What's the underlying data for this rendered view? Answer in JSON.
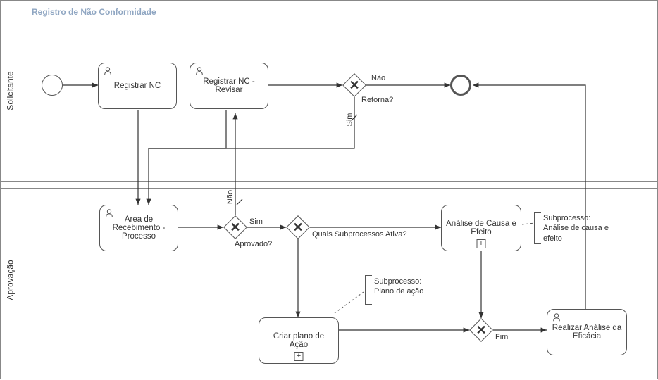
{
  "diagram": {
    "title": "Registro de Não Conformidade",
    "lanes": {
      "solicitante": {
        "label": "Solicitante"
      },
      "aprovacao": {
        "label": "Aprovação"
      }
    },
    "tasks": {
      "registrar_nc": {
        "label": "Registrar NC"
      },
      "registrar_nc_revisar": {
        "label": "Registrar NC - Revisar"
      },
      "area_recebimento": {
        "label": "Area de Recebimento - Processo"
      },
      "analise_causa": {
        "label": "Análise de Causa e Efeito"
      },
      "criar_plano": {
        "label": "Criar plano de Ação"
      },
      "realizar_eficacia": {
        "label": "Realizar Análise da Eficácia"
      }
    },
    "gateways": {
      "retorna": {
        "question": "Retorna?",
        "yes": "Sim",
        "no": "Não"
      },
      "aprovado": {
        "question": "Aprovado?",
        "yes": "Sim",
        "no": "Não"
      },
      "subprocessos": {
        "question": "Quais Subprocessos Ativa?"
      },
      "fim": {
        "label": "Fim"
      }
    },
    "annotations": {
      "analise_causa": {
        "title": "Subprocesso:",
        "body": "Análise de causa e efeito"
      },
      "plano_acao": {
        "title": "Subprocesso:",
        "body": "Plano de ação"
      }
    }
  },
  "chart_data": {
    "type": "bpmn",
    "pool": "Registro de Não Conformidade",
    "lanes": [
      "Solicitante",
      "Aprovação"
    ],
    "elements": [
      {
        "id": "start",
        "type": "startEvent",
        "lane": "Solicitante"
      },
      {
        "id": "t1",
        "type": "userTask",
        "lane": "Solicitante",
        "name": "Registrar NC"
      },
      {
        "id": "t2",
        "type": "userTask",
        "lane": "Solicitante",
        "name": "Registrar NC - Revisar"
      },
      {
        "id": "g1",
        "type": "exclusiveGateway",
        "lane": "Solicitante",
        "name": "Retorna?"
      },
      {
        "id": "end1",
        "type": "endEvent",
        "lane": "Solicitante"
      },
      {
        "id": "t3",
        "type": "userTask",
        "lane": "Aprovação",
        "name": "Area de Recebimento - Processo"
      },
      {
        "id": "g2",
        "type": "exclusiveGateway",
        "lane": "Aprovação",
        "name": "Aprovado?"
      },
      {
        "id": "g3",
        "type": "exclusiveGateway",
        "lane": "Aprovação",
        "name": "Quais Subprocessos Ativa?"
      },
      {
        "id": "t4",
        "type": "callActivity",
        "lane": "Aprovação",
        "name": "Análise de Causa e Efeito"
      },
      {
        "id": "t5",
        "type": "callActivity",
        "lane": "Aprovação",
        "name": "Criar plano de Ação"
      },
      {
        "id": "g4",
        "type": "exclusiveGateway",
        "lane": "Aprovação",
        "name": "Fim"
      },
      {
        "id": "t6",
        "type": "userTask",
        "lane": "Aprovação",
        "name": "Realizar Análise da Eficácia"
      }
    ],
    "flows": [
      {
        "from": "start",
        "to": "t1"
      },
      {
        "from": "t1",
        "to": "t3"
      },
      {
        "from": "t2",
        "to": "g1"
      },
      {
        "from": "g1",
        "to": "end1",
        "condition": "Não"
      },
      {
        "from": "g1",
        "to": "t3",
        "condition": "Sim"
      },
      {
        "from": "t3",
        "to": "g2"
      },
      {
        "from": "g2",
        "to": "t2",
        "condition": "Não"
      },
      {
        "from": "g2",
        "to": "g3",
        "condition": "Sim"
      },
      {
        "from": "g3",
        "to": "t4"
      },
      {
        "from": "g3",
        "to": "t5"
      },
      {
        "from": "t4",
        "to": "g4"
      },
      {
        "from": "t5",
        "to": "g4"
      },
      {
        "from": "g4",
        "to": "t6"
      },
      {
        "from": "t6",
        "to": "end1"
      },
      {
        "from": "t2",
        "to": "t3"
      }
    ],
    "annotations": [
      {
        "attachedTo": "t4",
        "text": "Subprocesso: Análise de causa e efeito"
      },
      {
        "attachedTo": "t5",
        "text": "Subprocesso: Plano de ação"
      }
    ]
  }
}
